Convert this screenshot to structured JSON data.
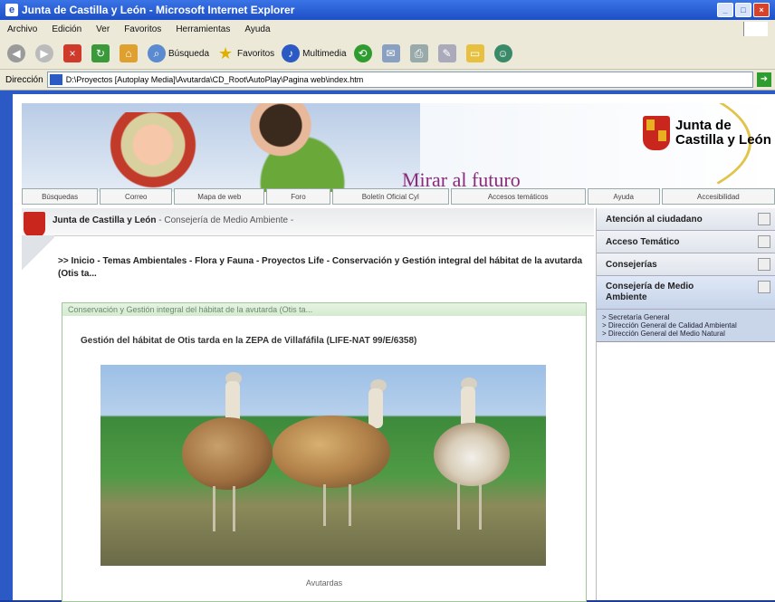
{
  "window": {
    "title": "Junta de Castilla y León - Microsoft Internet Explorer"
  },
  "menubar": [
    "Archivo",
    "Edición",
    "Ver",
    "Favoritos",
    "Herramientas",
    "Ayuda"
  ],
  "toolbar": {
    "search_label": "Búsqueda",
    "favorites_label": "Favoritos",
    "multimedia_label": "Multimedia"
  },
  "addressbar": {
    "label": "Dirección",
    "url": "D:\\Proyectos [Autoplay Media]\\Avutarda\\CD_Root\\AutoPlay\\Pagina web\\index.htm"
  },
  "banner": {
    "slogan": "Mirar al futuro",
    "logo_line1": "Junta de",
    "logo_line2": "Castilla y León"
  },
  "navtabs": [
    "Búsquedas",
    "Correo",
    "Mapa de web",
    "Foro",
    "Boletín Oficial Cyl",
    "Accesos temáticos",
    "Ayuda",
    "Accesibilidad"
  ],
  "header": {
    "org": "Junta de Castilla y León",
    "dept": "- Consejería de Medio Ambiente -"
  },
  "breadcrumb": ">> Inicio - Temas Ambientales - Flora y Fauna - Proyectos Life - Conservación y Gestión integral del hábitat de la avutarda (Otis ta...",
  "content": {
    "box_title": "Conservación y Gestión integral del hábitat de la avutarda (Otis ta...",
    "caption": "Gestión del hábitat de Otis tarda en la ZEPA de Villafáfila (LIFE-NAT 99/E/6358)",
    "photo_credit": "Avutardas"
  },
  "rightcol": {
    "items": [
      "Atención al ciudadano",
      "Acceso Temático",
      "Consejerías",
      "Consejería de Medio Ambiente"
    ],
    "sublinks": [
      "> Secretaría General",
      "> Dirección General de Calidad Ambiental",
      "> Dirección General del Medio Natural"
    ]
  }
}
